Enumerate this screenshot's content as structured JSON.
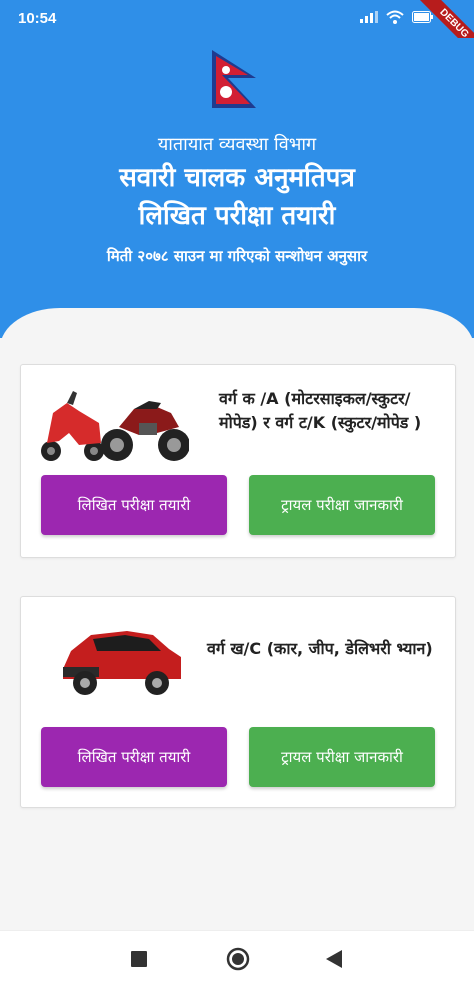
{
  "status": {
    "time": "10:54",
    "debug": "DEBUG"
  },
  "header": {
    "department": "यातायात व्यवस्था विभाग",
    "title_line1": "सवारी चालक अनुमतिपत्र",
    "title_line2": "लिखित परीक्षा तयारी",
    "revision_note": "मिती २०७८ साउन मा गरिएको सन्शोधन अनुसार"
  },
  "cards": [
    {
      "category_label": "वर्ग क /A (मोटरसाइकल/स्कुटर/मोपेड) र वर्ग ट/K (स्कुटर/मोपेड )",
      "written_button": "लिखित परीक्षा तयारी",
      "trial_button": "ट्रायल परीक्षा जानकारी"
    },
    {
      "category_label": "वर्ग ख/C (कार, जीप, डेलिभरी भ्यान)",
      "written_button": "लिखित परीक्षा तयारी",
      "trial_button": "ट्रायल परीक्षा जानकारी"
    }
  ],
  "colors": {
    "header": "#2f8fe8",
    "written": "#9c27b0",
    "trial": "#4caf50"
  },
  "navbar": {
    "icons": [
      "recents-square-icon",
      "home-circle-icon",
      "back-triangle-icon"
    ]
  }
}
